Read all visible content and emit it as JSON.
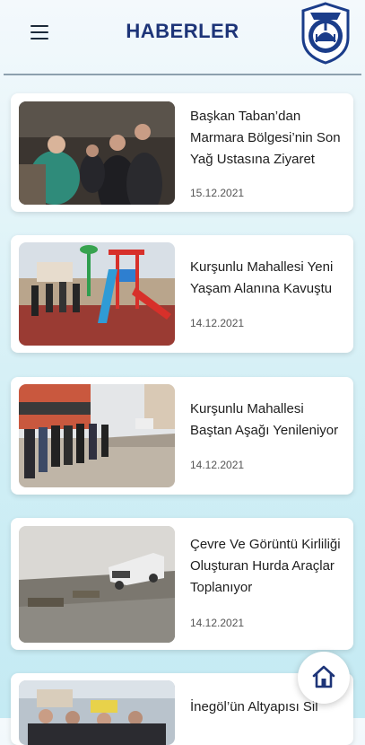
{
  "header": {
    "title": "HABERLER"
  },
  "news": [
    {
      "title": "Başkan Taban’dan Marmara Bölgesi’nin Son Yağ Ustasına Ziyaret",
      "date": "15.12.2021"
    },
    {
      "title": "Kurşunlu Mahallesi Yeni Yaşam Alanına Kavuştu",
      "date": "14.12.2021"
    },
    {
      "title": "Kurşunlu Mahallesi Baştan Aşağı Yenileniyor",
      "date": "14.12.2021"
    },
    {
      "title": "Çevre Ve Görüntü Kirliliği Oluşturan Hurda Araçlar Toplanıyor",
      "date": "14.12.2021"
    },
    {
      "title": "İnegöl’ün Altyapısı Sil",
      "date": ""
    }
  ],
  "icons": {
    "menu": "hamburger-menu-icon",
    "home": "home-icon",
    "logo": "municipality-logo"
  },
  "colors": {
    "title": "#1d3478",
    "logo": "#1b3d8a",
    "home_icon": "#1d3478"
  }
}
